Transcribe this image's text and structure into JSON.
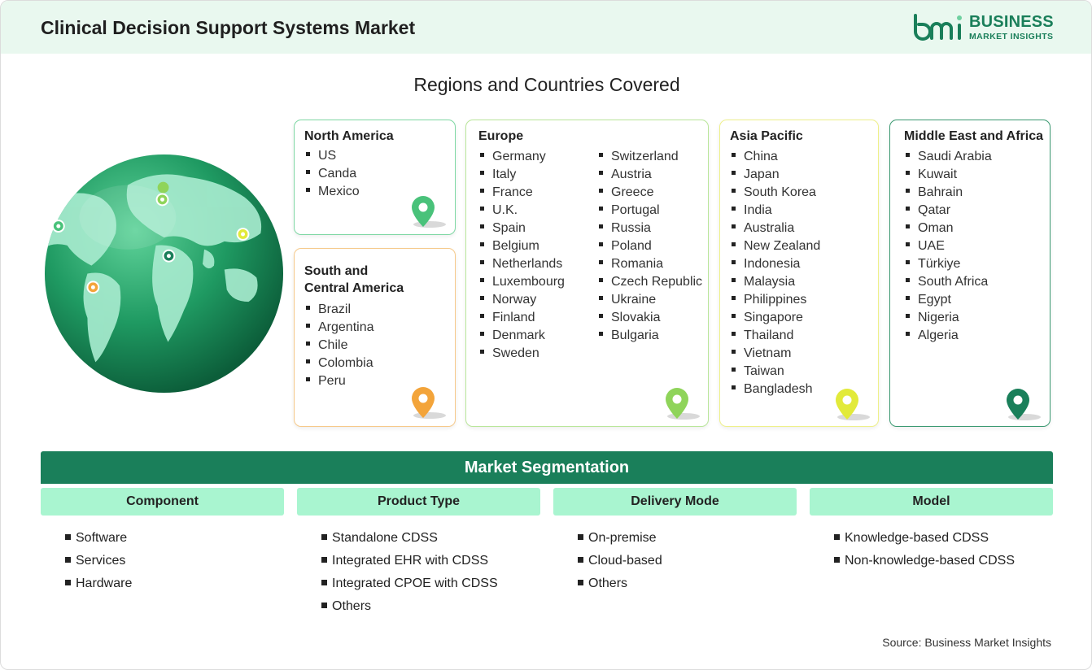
{
  "header": {
    "title": "Clinical Decision Support Systems Market"
  },
  "logo": {
    "line1": "BUSINESS",
    "line2": "MARKET INSIGHTS",
    "color": "#1a7f5a"
  },
  "regions_title": "Regions and Countries Covered",
  "regions": {
    "north_america": {
      "title": "North America",
      "color": "#49c27a",
      "items": [
        "US",
        "Canda",
        "Mexico"
      ]
    },
    "south_america": {
      "title_line1": "South and",
      "title_line2": "Central America",
      "color": "#f3a43a",
      "items": [
        "Brazil",
        "Argentina",
        "Chile",
        "Colombia",
        "Peru"
      ]
    },
    "europe": {
      "title": "Europe",
      "color": "#8fd45a",
      "items_left": [
        "Germany",
        "Italy",
        "France",
        "U.K.",
        "Spain",
        "Belgium",
        "Netherlands",
        "Luxembourg",
        "Norway",
        "Finland",
        "Denmark",
        "Sweden"
      ],
      "items_right": [
        "Switzerland",
        "Austria",
        "Greece",
        "Portugal",
        "Russia",
        "Poland",
        "Romania",
        "Czech Republic",
        "Ukraine",
        "Slovakia",
        "Bulgaria"
      ]
    },
    "asia_pacific": {
      "title": "Asia Pacific",
      "color": "#e2ea3a",
      "items": [
        "China",
        "Japan",
        "South Korea",
        "India",
        "Australia",
        "New Zealand",
        "Indonesia",
        "Malaysia",
        "Philippines",
        "Singapore",
        "Thailand",
        "Vietnam",
        "Taiwan",
        "Bangladesh"
      ]
    },
    "middle_east_africa": {
      "title": "Middle East and Africa",
      "color": "#1a7f5a",
      "items": [
        "Saudi Arabia",
        "Kuwait",
        "Bahrain",
        "Qatar",
        "Oman",
        "UAE",
        "Türkiye",
        "South Africa",
        "Egypt",
        "Nigeria",
        "Algeria"
      ]
    }
  },
  "segmentation": {
    "title": "Market Segmentation",
    "columns": [
      {
        "label": "Component",
        "items": [
          "Software",
          "Services",
          "Hardware"
        ]
      },
      {
        "label": "Product Type",
        "items": [
          "Standalone CDSS",
          "Integrated EHR with CDSS",
          "Integrated CPOE with CDSS",
          "Others"
        ]
      },
      {
        "label": "Delivery Mode",
        "items": [
          "On-premise",
          "Cloud-based",
          "Others"
        ]
      },
      {
        "label": "Model",
        "items": [
          "Knowledge-based CDSS",
          "Non-knowledge-based CDSS"
        ]
      }
    ]
  },
  "source": "Source: Business Market Insights"
}
